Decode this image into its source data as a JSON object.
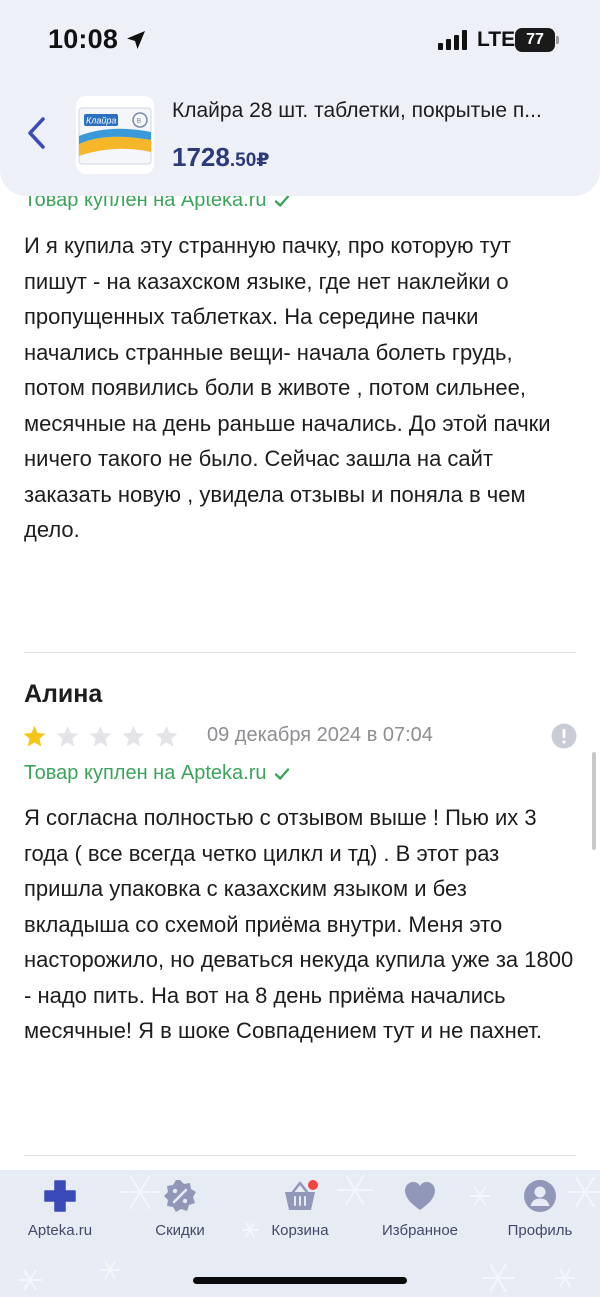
{
  "status_bar": {
    "time": "10:08",
    "network": "LTE",
    "battery": "77"
  },
  "product": {
    "name": "Клайра 28 шт. таблетки, покрытые п...",
    "price_main": "1728",
    "price_kopecks": ".50",
    "currency": "₽",
    "thumb_brand": "Клайра"
  },
  "reviews": [
    {
      "verified": "Товар куплен на Apteka.ru",
      "text": "И я купила эту странную пачку, про которую тут пишут - на казахском языке, где нет наклейки о пропущенных таблетках. На середине пачки начались странные вещи- начала болеть грудь, потом появились боли в животе , потом сильнее, месячные на день раньше начались. До этой пачки ничего такого не было. Сейчас зашла на сайт заказать новую , увидела отзывы и поняла в чем дело."
    },
    {
      "author": "Алина",
      "rating": 1,
      "max_rating": 5,
      "date": "09 декабря 2024 в 07:04",
      "verified": "Товар куплен на Apteka.ru",
      "text": "Я согласна полностью с отзывом выше ! Пью их 3 года ( все всегда четко цилкл и тд) . В этот раз пришла упаковка с казахским языком и без вкладыша со схемой приёма внутри. Меня это насторожило, но деваться некуда купила уже за 1800 - надо пить. На вот на 8 день приёма начались месячные! Я в шоке Совпадением тут и не пахнет."
    }
  ],
  "tab_bar": {
    "items": [
      {
        "label": "Apteka.ru",
        "icon": "cross-icon"
      },
      {
        "label": "Скидки",
        "icon": "discount-icon"
      },
      {
        "label": "Корзина",
        "icon": "basket-icon"
      },
      {
        "label": "Избранное",
        "icon": "heart-icon"
      },
      {
        "label": "Профиль",
        "icon": "profile-icon"
      }
    ]
  },
  "colors": {
    "accent": "#3a4bb8",
    "verified": "#3aa55a",
    "star_filled": "#f5c518",
    "star_empty": "#e4e4e8",
    "badge": "#f2453d"
  }
}
